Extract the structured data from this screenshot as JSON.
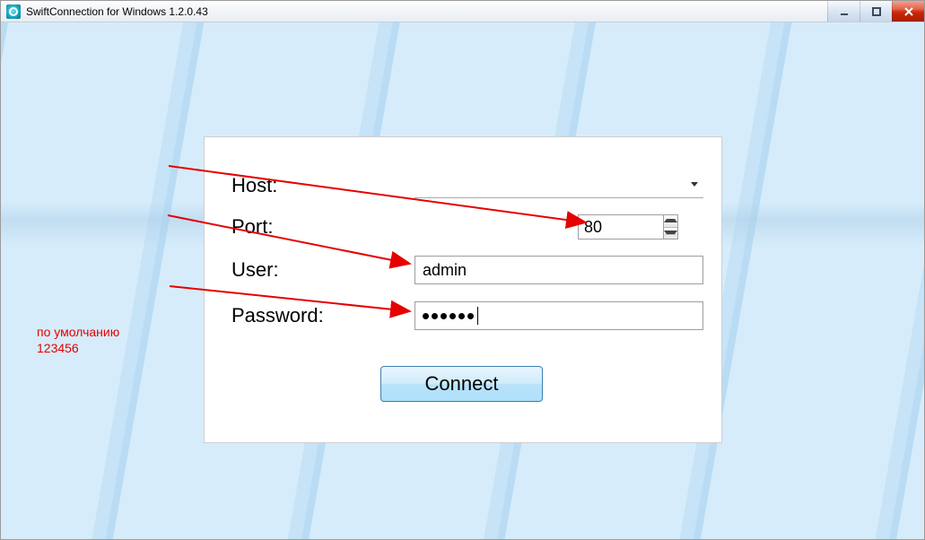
{
  "window": {
    "title": "SwiftConnection for Windows 1.2.0.43"
  },
  "form": {
    "host_label": "Host:",
    "host_value": "",
    "port_label": "Port:",
    "port_value": "80",
    "user_label": "User:",
    "user_value": "admin",
    "password_label": "Password:",
    "password_value": "●●●●●●",
    "connect_label": "Connect"
  },
  "annotation": {
    "line1": "по умолчанию",
    "line2": "123456"
  }
}
